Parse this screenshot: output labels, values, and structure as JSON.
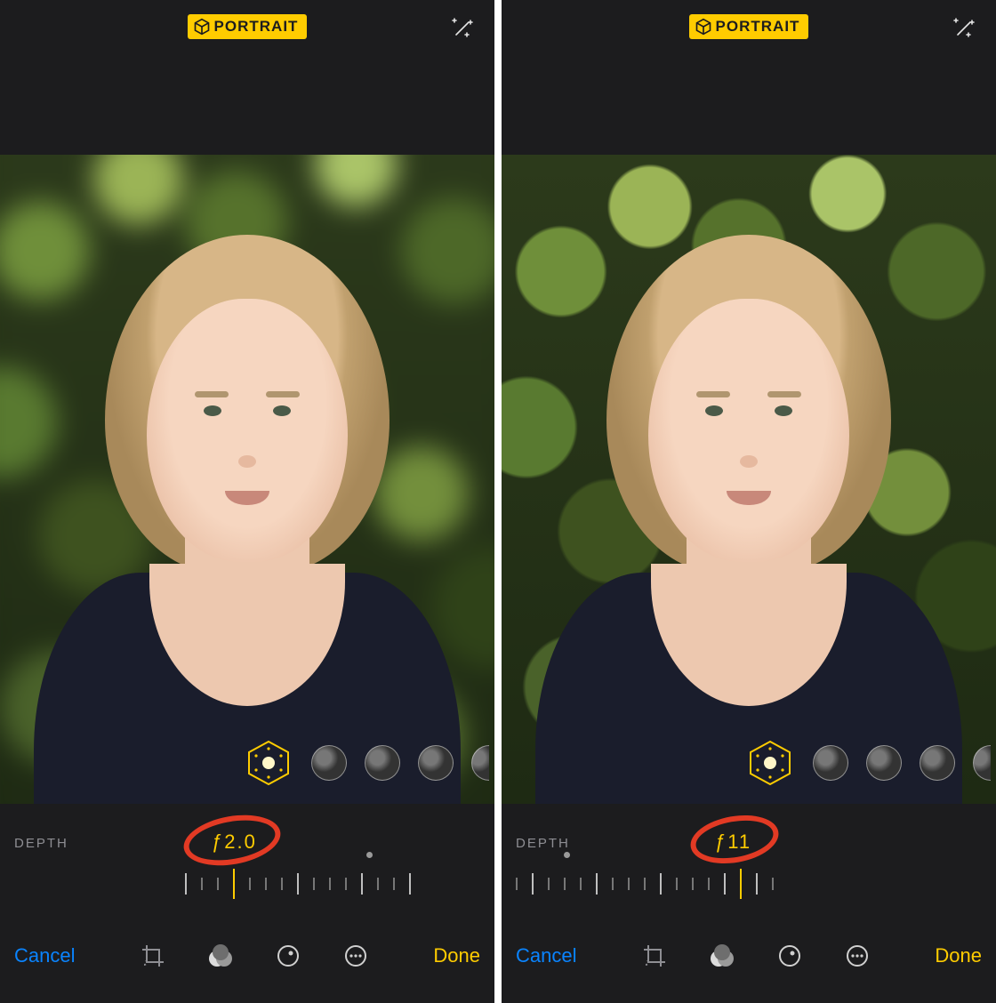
{
  "left": {
    "mode_badge": "PORTRAIT",
    "depth_label": "DEPTH",
    "depth_value": "ƒ2.0",
    "cancel": "Cancel",
    "done": "Done"
  },
  "right": {
    "mode_badge": "PORTRAIT",
    "depth_label": "DEPTH",
    "depth_value": "ƒ11",
    "cancel": "Cancel",
    "done": "Done"
  },
  "colors": {
    "accent_yellow": "#ffcc00",
    "ios_blue": "#0a84ff",
    "annotation_red": "#e23a24"
  }
}
